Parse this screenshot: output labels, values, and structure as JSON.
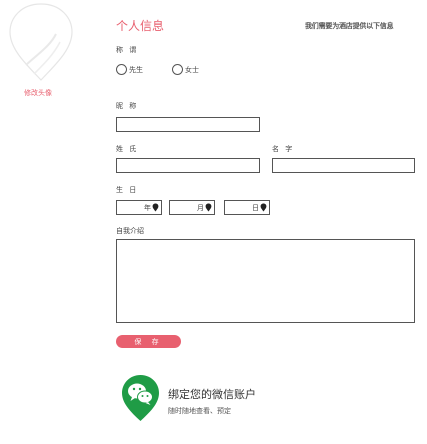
{
  "avatar": {
    "change_label": "修改头像"
  },
  "profile": {
    "title": "个人信息",
    "note": "我们需要为酒店提供以下信息"
  },
  "title_field": {
    "label": "称 谓",
    "options": [
      {
        "label": "先生",
        "checked": false
      },
      {
        "label": "女士",
        "checked": false
      }
    ]
  },
  "nickname": {
    "label": "昵 称",
    "value": ""
  },
  "surname": {
    "label": "姓 氏",
    "value": ""
  },
  "given_name": {
    "label": "名 字",
    "value": ""
  },
  "birthday": {
    "label": "生 日",
    "year": "年",
    "month": "月",
    "day": "日"
  },
  "bio": {
    "label": "自我介绍",
    "value": ""
  },
  "save_label": "保 存",
  "wechat": {
    "title": "绑定您的微信账户",
    "subtitle": "随时随地查看、预定",
    "icon": "wechat-icon",
    "color": "#1f9c46"
  },
  "colors": {
    "accent": "#e8606f",
    "border": "#555555"
  }
}
